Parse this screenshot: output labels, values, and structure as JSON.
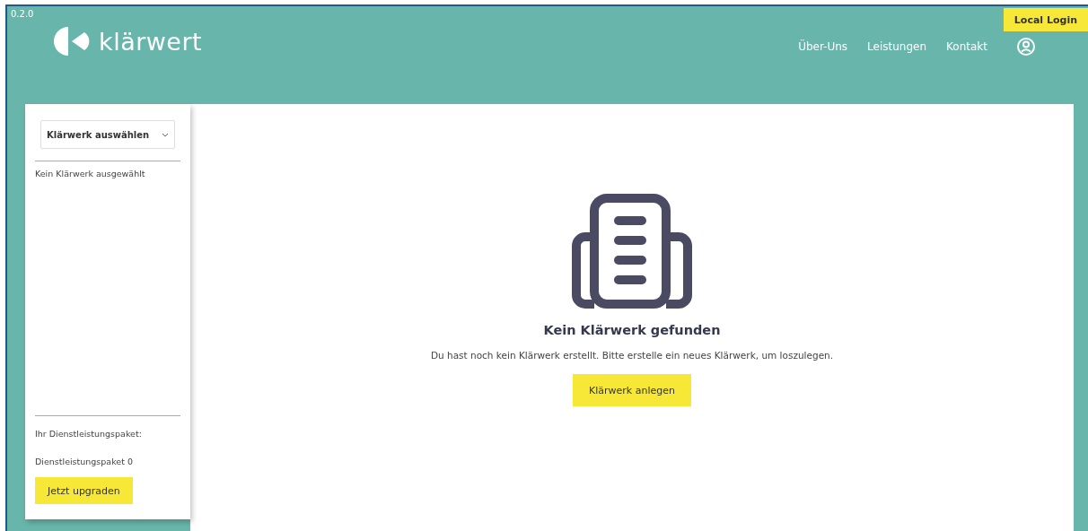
{
  "version": "0.2.0",
  "brand": {
    "name": "klärwert"
  },
  "nav": {
    "links": [
      {
        "label": "Über-Uns"
      },
      {
        "label": "Leistungen"
      },
      {
        "label": "Kontakt"
      }
    ],
    "login_button": "Local Login"
  },
  "sidebar": {
    "select": {
      "label": "Klärwerk auswählen"
    },
    "status": "Kein Klärwerk ausgewählt",
    "package_label": "Ihr Dienstleistungspaket:",
    "package_value": "Dienstleistungspaket 0",
    "upgrade_button": "Jetzt upgraden"
  },
  "empty_state": {
    "title": "Kein Klärwerk gefunden",
    "message": "Du hast noch kein Klärwerk erstellt. Bitte erstelle ein neues Klärwerk, um loszulegen.",
    "button": "Klärwerk anlegen"
  }
}
